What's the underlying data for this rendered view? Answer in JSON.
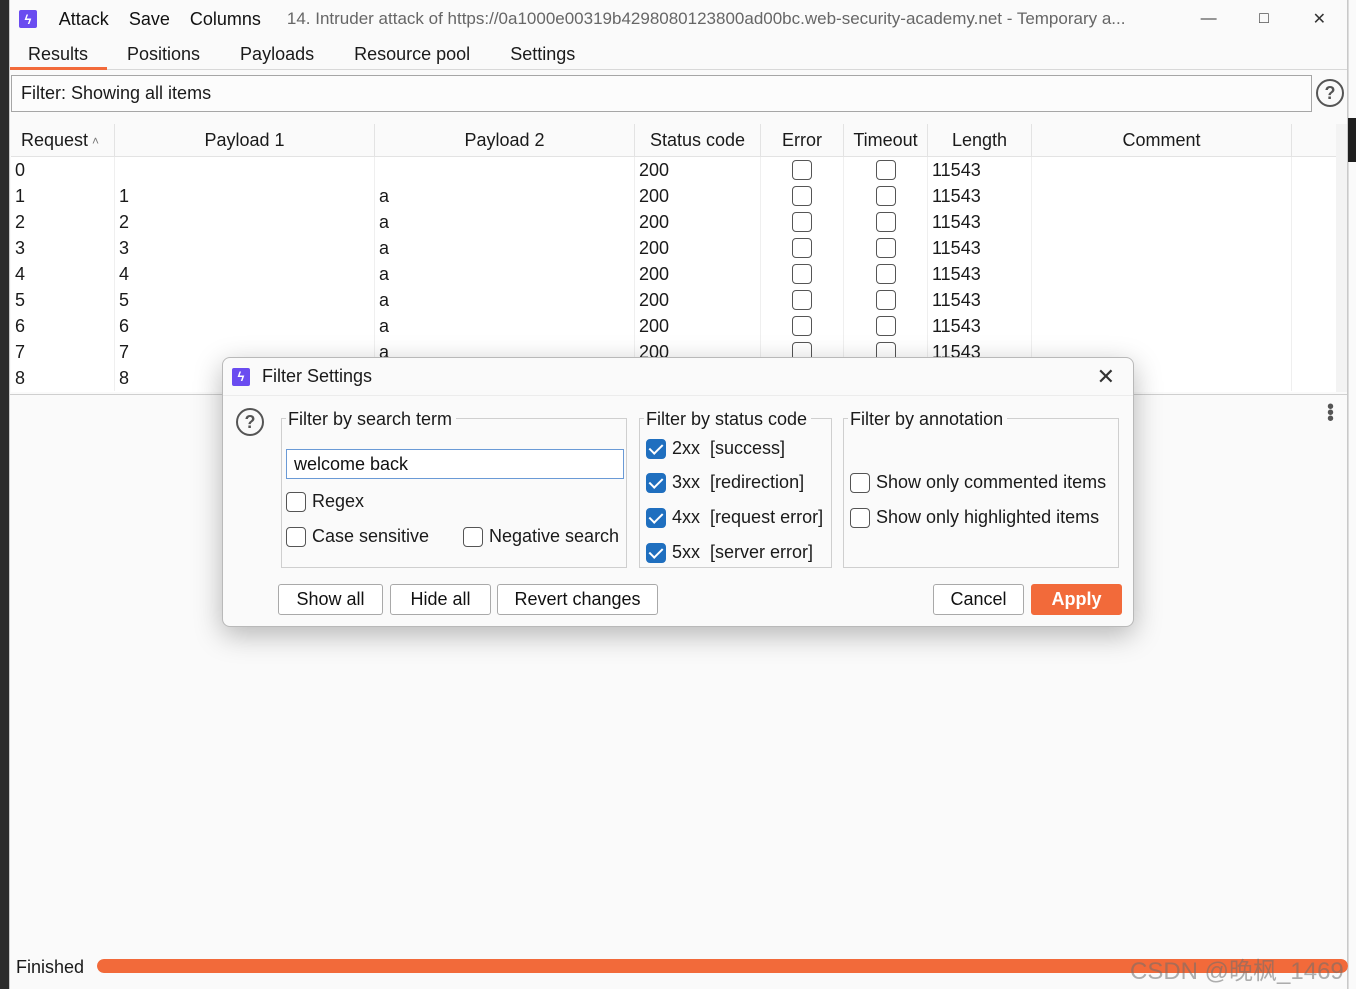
{
  "menu": {
    "attack": "Attack",
    "save": "Save",
    "columns": "Columns"
  },
  "window_title": "14. Intruder attack of https://0a1000e00319b4298080123800ad00bc.web-security-academy.net - Temporary a...",
  "tabs": [
    "Results",
    "Positions",
    "Payloads",
    "Resource pool",
    "Settings"
  ],
  "filter_bar": "Filter: Showing all items",
  "table": {
    "headers": [
      "Request",
      "Payload 1",
      "Payload 2",
      "Status code",
      "Error",
      "Timeout",
      "Length",
      "Comment"
    ],
    "rows": [
      [
        "0",
        "",
        "",
        "200",
        "11543"
      ],
      [
        "1",
        "1",
        "a",
        "200",
        "11543"
      ],
      [
        "2",
        "2",
        "a",
        "200",
        "11543"
      ],
      [
        "3",
        "3",
        "a",
        "200",
        "11543"
      ],
      [
        "4",
        "4",
        "a",
        "200",
        "11543"
      ],
      [
        "5",
        "5",
        "a",
        "200",
        "11543"
      ],
      [
        "6",
        "6",
        "a",
        "200",
        "11543"
      ],
      [
        "7",
        "7",
        "a",
        "200",
        "11543"
      ],
      [
        "8",
        "8",
        "",
        "",
        ""
      ]
    ]
  },
  "status": {
    "text": "Finished",
    "progress_percent": 100
  },
  "watermark": "CSDN @晚枫_1469",
  "dialog": {
    "title": "Filter Settings",
    "search_group": {
      "legend": "Filter by search term",
      "value": "welcome back",
      "regex": "Regex",
      "case_sensitive": "Case sensitive",
      "negative": "Negative search"
    },
    "status_group": {
      "legend": "Filter by status code",
      "options": [
        {
          "code": "2xx",
          "label": "[success]",
          "checked": true
        },
        {
          "code": "3xx",
          "label": "[redirection]",
          "checked": true
        },
        {
          "code": "4xx",
          "label": "[request error]",
          "checked": true
        },
        {
          "code": "5xx",
          "label": "[server error]",
          "checked": true
        }
      ]
    },
    "annotation_group": {
      "legend": "Filter by annotation",
      "commented": "Show only commented items",
      "highlighted": "Show only highlighted items"
    },
    "buttons": {
      "show_all": "Show all",
      "hide_all": "Hide all",
      "revert": "Revert changes",
      "cancel": "Cancel",
      "apply": "Apply"
    }
  },
  "colors": {
    "accent": "#f26a3a",
    "check": "#1f6fbf",
    "brand": "#6a4cf0"
  }
}
